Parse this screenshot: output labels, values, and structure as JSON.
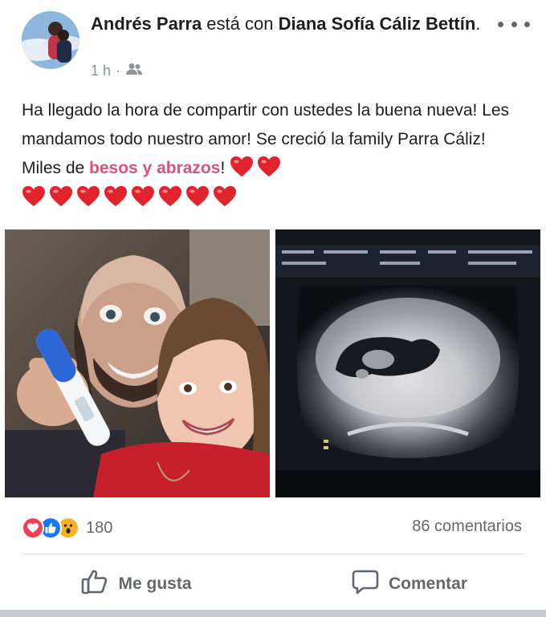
{
  "post": {
    "author": "Andrés Parra",
    "connector": " está con ",
    "tagged": "Diana Sofía Cáliz Bettín",
    "tagged_suffix": ".",
    "time": "1 h",
    "separator": "·",
    "audience_icon": "friends-icon",
    "text_line_1": "Ha llegado la hora de compartir con ustedes la buena nueva! Les mandamos todo nuestro amor! Se creció la family Parra Cáliz! Miles de ",
    "hashtag": "besos y abrazos",
    "text_after_hashtag": "! ",
    "heart_count_inline": 2,
    "heart_count_row": 8,
    "heart_color": "#e0232d"
  },
  "reactions": {
    "icons": [
      "love-reaction-icon",
      "like-reaction-icon",
      "wow-reaction-icon"
    ],
    "count": "180"
  },
  "comments_label": "86 comentarios",
  "actions": {
    "like": "Me gusta",
    "comment": "Comentar"
  },
  "colors": {
    "link_pink": "#d9537a",
    "secondary_text": "#65676b",
    "like_blue": "#1877f2",
    "love_red": "#f33e58",
    "wow_yellow": "#f7b125"
  }
}
